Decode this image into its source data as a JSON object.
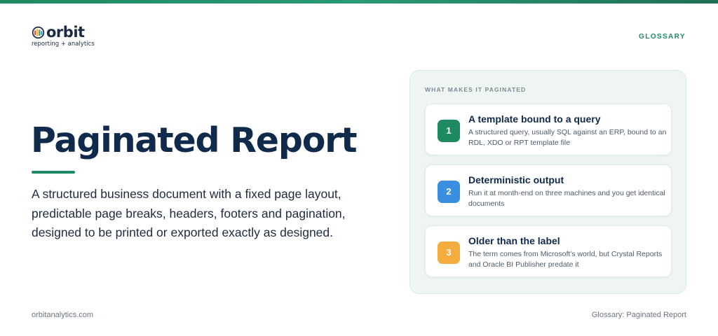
{
  "brand": {
    "name": "orbit",
    "tagline": "reporting + analytics",
    "accent_color": "#1e8a62",
    "logo_colors": [
      "#e2504c",
      "#f2b33d",
      "#3fa66a",
      "#2f8fd8"
    ]
  },
  "header": {
    "section_label": "GLOSSARY"
  },
  "main": {
    "title": "Paginated Report",
    "description": "A structured business document with a fixed page layout, predictable page breaks, headers, footers and pagination, designed to be printed or exported exactly as designed."
  },
  "panel": {
    "heading": "WHAT MAKES IT PAGINATED",
    "items": [
      {
        "number": "1",
        "title": "A template bound to a query",
        "text": "A structured query, usually SQL against an ERP, bound to an RDL, XDO or RPT template file",
        "color": "#1e8a62"
      },
      {
        "number": "2",
        "title": "Deterministic output",
        "text": "Run it at month-end on three machines and you get identical documents",
        "color": "#3a8fe0"
      },
      {
        "number": "3",
        "title": "Older than the label",
        "text": "The term comes from Microsoft's world, but Crystal Reports and Oracle BI Publisher predate it",
        "color": "#f5ac3f"
      }
    ]
  },
  "footer": {
    "website": "orbitanalytics.com",
    "page_label": "Glossary: Paginated Report"
  }
}
